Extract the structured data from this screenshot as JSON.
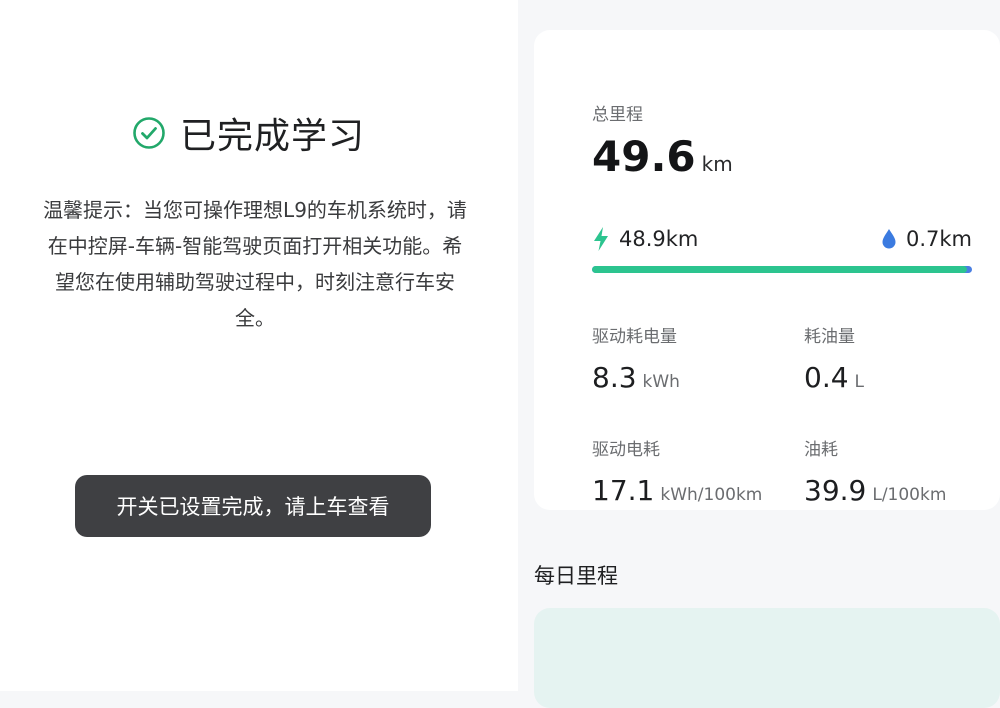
{
  "learning": {
    "status_title": "已完成学习",
    "tip_text": "温馨提示：当您可操作理想L9的车机系统时，请在中控屏-车辆-智能驾驶页面打开相关功能。希望您在使用辅助驾驶过程中，时刻注意行车安全。",
    "toast_text": "开关已设置完成，请上车查看"
  },
  "mileage": {
    "total_label": "总里程",
    "total_value": "49.6",
    "total_unit": "km",
    "electric": {
      "icon": "lightning-icon",
      "value": "48.9km",
      "color": "#2cc48f"
    },
    "fuel": {
      "icon": "droplet-icon",
      "value": "0.7km",
      "color": "#3b7be0"
    },
    "electric_fraction": 0.986
  },
  "stats": [
    {
      "label": "驱动耗电量",
      "value": "8.3",
      "unit": "kWh"
    },
    {
      "label": "耗油量",
      "value": "0.4",
      "unit": "L"
    },
    {
      "label": "驱动电耗",
      "value": "17.1",
      "unit": "kWh/100km"
    },
    {
      "label": "油耗",
      "value": "39.9",
      "unit": "L/100km"
    }
  ],
  "daily": {
    "title": "每日里程"
  },
  "colors": {
    "accent_green": "#2cc48f",
    "accent_blue": "#3b7be0",
    "toast_bg": "#3f4043"
  }
}
